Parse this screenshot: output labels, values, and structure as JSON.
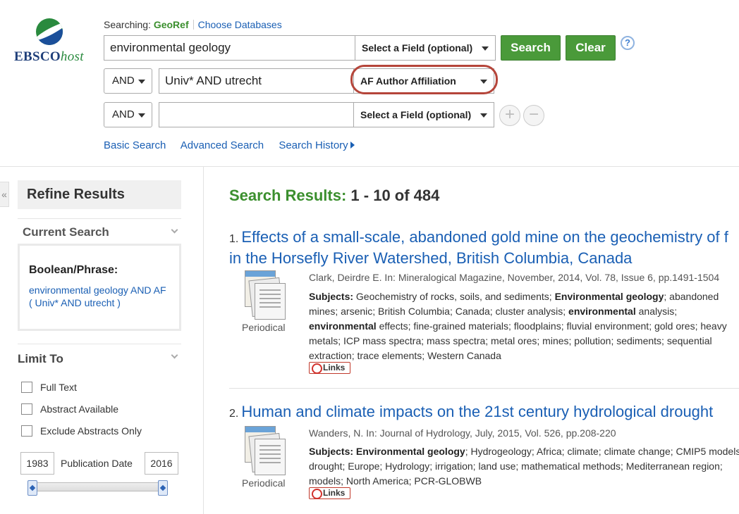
{
  "logo": {
    "brand": "EBSCO",
    "brand_suffix": "host"
  },
  "searching": {
    "label": "Searching:",
    "database": "GeoRef",
    "choose_db": "Choose Databases"
  },
  "search_rows": [
    {
      "operator": "",
      "value": "environmental geology",
      "field": "Select a Field (optional)"
    },
    {
      "operator": "AND",
      "value": "Univ* AND utrecht",
      "field": "AF Author Affiliation"
    },
    {
      "operator": "AND",
      "value": "",
      "field": "Select a Field (optional)"
    }
  ],
  "buttons": {
    "search": "Search",
    "clear": "Clear",
    "help": "?",
    "add": "+",
    "remove": "−"
  },
  "search_links": {
    "basic": "Basic Search",
    "advanced": "Advanced Search",
    "history": "Search History"
  },
  "sidebar": {
    "collapse": "«",
    "refine_title": "Refine Results",
    "current_search_title": "Current Search",
    "boolean_label": "Boolean/Phrase:",
    "query_text": "environmental geology AND AF ( Univ* AND utrecht )",
    "limit_title": "Limit To",
    "limits": [
      "Full Text",
      "Abstract Available",
      "Exclude Abstracts Only"
    ],
    "pub_date": {
      "label": "Publication Date",
      "from": "1983",
      "to": "2016"
    }
  },
  "results_header": {
    "label": "Search Results:",
    "range": "1 - 10 of 484"
  },
  "results": [
    {
      "num": "1.",
      "title_line1": "Effects of a small-scale, abandoned gold mine on the geochemistry of f",
      "title_line2": "in the Horsefly River Watershed, British Columbia, Canada",
      "type": "Periodical",
      "source": "Clark, Deirdre E. In: Mineralogical Magazine, November, 2014, Vol. 78, Issue 6, pp.1491-1504",
      "subjects_label": "Subjects:",
      "links": "Links"
    },
    {
      "num": "2.",
      "title_line1": "Human and climate impacts on the 21st century hydrological drought",
      "type": "Periodical",
      "source": "Wanders, N. In: Journal of Hydrology, July, 2015, Vol. 526, pp.208-220",
      "subjects_label": "Subjects:",
      "links": "Links"
    }
  ],
  "colors": {
    "green": "#4a9a3a",
    "link": "#1a5fb4",
    "highlight": "#b5453a"
  }
}
